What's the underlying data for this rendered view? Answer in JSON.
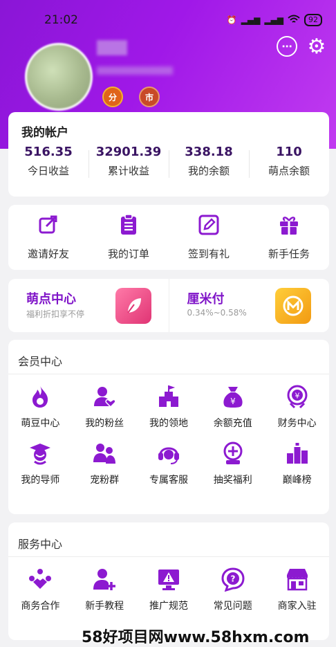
{
  "status_bar": {
    "time": "21:02",
    "battery": "92"
  },
  "badges": {
    "fen": "分",
    "shi": "市"
  },
  "account": {
    "title": "我的帐户",
    "stats": [
      {
        "value": "516.35",
        "label": "今日收益"
      },
      {
        "value": "32901.39",
        "label": "累计收益"
      },
      {
        "value": "338.18",
        "label": "我的余额"
      },
      {
        "value": "110",
        "label": "萌点余额"
      }
    ]
  },
  "actions": [
    {
      "label": "邀请好友",
      "icon": "share-edit-icon"
    },
    {
      "label": "我的订单",
      "icon": "clipboard-list-icon"
    },
    {
      "label": "签到有礼",
      "icon": "edit-pen-icon"
    },
    {
      "label": "新手任务",
      "icon": "gift-icon"
    }
  ],
  "promos": [
    {
      "title": "萌点中心",
      "subtitle": "福利折扣享不停",
      "icon": "feather-tile-icon"
    },
    {
      "title": "厘米付",
      "subtitle": "0.34%~0.58%",
      "icon": "m-pay-tile-icon"
    }
  ],
  "member_center": {
    "title": "会员中心",
    "items": [
      {
        "label": "萌豆中心",
        "icon": "flame-icon"
      },
      {
        "label": "我的粉丝",
        "icon": "user-heart-icon"
      },
      {
        "label": "我的领地",
        "icon": "castle-icon"
      },
      {
        "label": "余额充值",
        "icon": "money-bag-icon"
      },
      {
        "label": "财务中心",
        "icon": "yen-coin-icon"
      },
      {
        "label": "我的导师",
        "icon": "graduate-icon"
      },
      {
        "label": "宠粉群",
        "icon": "group-icon"
      },
      {
        "label": "专属客服",
        "icon": "headset-icon"
      },
      {
        "label": "抽奖福利",
        "icon": "lottery-icon"
      },
      {
        "label": "巅峰榜",
        "icon": "podium-icon"
      }
    ]
  },
  "service_center": {
    "title": "服务中心",
    "items": [
      {
        "label": "商务合作",
        "icon": "handshake-icon"
      },
      {
        "label": "新手教程",
        "icon": "user-plus-icon"
      },
      {
        "label": "推广规范",
        "icon": "warning-monitor-icon"
      },
      {
        "label": "常见问题",
        "icon": "question-bubble-icon"
      },
      {
        "label": "商家入驻",
        "icon": "storefront-icon"
      }
    ]
  },
  "watermark": "58好项目网www.58hxm.com",
  "colors": {
    "brand_purple": "#8a16d6",
    "icon_purple": "#8c1ad0",
    "stat_text": "#3a1463"
  }
}
